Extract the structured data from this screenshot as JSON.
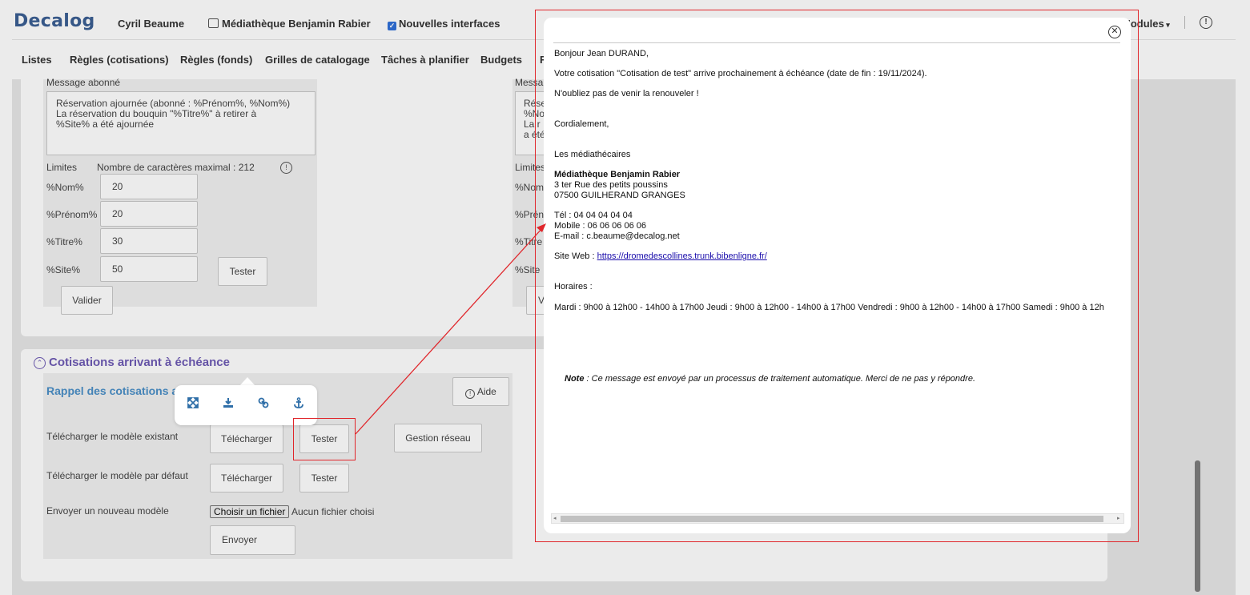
{
  "topbar": {
    "logo": "Decalog",
    "user": "Cyril Beaume",
    "library": "Médiathèque Benjamin Rabier",
    "new_interfaces_label": "Nouvelles interfaces",
    "modules_label": "Modules"
  },
  "nav": {
    "items": [
      "Listes",
      "Règles (cotisations)",
      "Règles (fonds)",
      "Grilles de catalogage",
      "Tâches à planifier",
      "Budgets",
      "F"
    ]
  },
  "message_panel": {
    "title": "Message abonné",
    "text": "Réservation ajournée (abonné : %Prénom%, %Nom%)\nLa réservation du bouquin \"%Titre%\" à retirer à\n%Site% a été ajournée",
    "limits_label": "Limites",
    "max_chars_label": "Nombre de caractères maximal : 212",
    "fields": [
      {
        "label": "%Nom%",
        "value": "20"
      },
      {
        "label": "%Prénom%",
        "value": "20"
      },
      {
        "label": "%Titre%",
        "value": "30"
      },
      {
        "label": "%Site%",
        "value": "50"
      }
    ],
    "test_button": "Tester",
    "validate_button": "Valider"
  },
  "message_panel_right": {
    "title": "Messa",
    "text_lines": [
      "Rése",
      "%No",
      "La r",
      "a été"
    ],
    "limits_label": "Limites",
    "fields": [
      "%Nom",
      "%Prén",
      "%Titre",
      "%Site"
    ],
    "validate_fragment": "V"
  },
  "cotisations": {
    "section_title": "Cotisations arrivant à échéance",
    "sub_title": "Rappel des cotisations ar",
    "help_button": "Aide",
    "rows": [
      {
        "label": "Télécharger le modèle existant",
        "download": "Télécharger",
        "test": "Tester",
        "network": "Gestion réseau"
      },
      {
        "label": "Télécharger le modèle par défaut",
        "download": "Télécharger",
        "test": "Tester"
      }
    ],
    "upload_label": "Envoyer un nouveau modèle",
    "choose_file": "Choisir un fichier",
    "no_file": "Aucun fichier choisi",
    "send_button": "Envoyer"
  },
  "popover": {
    "icons": [
      "expand-icon",
      "download-icon",
      "link-icon",
      "anchor-icon"
    ]
  },
  "modal": {
    "greeting": "Bonjour Jean DURAND,",
    "line1": "Votre cotisation \"Cotisation de test\" arrive prochainement à échéance (date de fin : 19/11/2024).",
    "line2": "N'oubliez pas de venir la renouveler !",
    "closing": "Cordialement,",
    "signature": "Les médiathécaires",
    "library_name": "Médiathèque Benjamin Rabier",
    "address1": "3 ter Rue des petits poussins",
    "address2": "07500 GUILHERAND GRANGES",
    "tel": "Tél : 04 04 04 04 04",
    "mobile": "Mobile : 06 06 06 06 06",
    "email": "E-mail : c.beaume@decalog.net",
    "site_label": "Site Web : ",
    "site_url": "https://dromedescollines.trunk.bibenligne.fr/",
    "hours_label": "Horaires :",
    "hours": "Mardi : 9h00 à 12h00 - 14h00 à 17h00 Jeudi : 9h00 à 12h00 - 14h00 à 17h00 Vendredi : 9h00 à 12h00 - 14h00 à 17h00 Samedi : 9h00 à 12h",
    "note_label": "Note",
    "note_text": " : Ce message est envoyé par un processus de traitement automatique. Merci de ne pas y répondre."
  },
  "colors": {
    "accent": "#3b5f93",
    "section_title": "#6e5bb5",
    "annotation": "#e0262b",
    "link": "#1a0dab"
  }
}
